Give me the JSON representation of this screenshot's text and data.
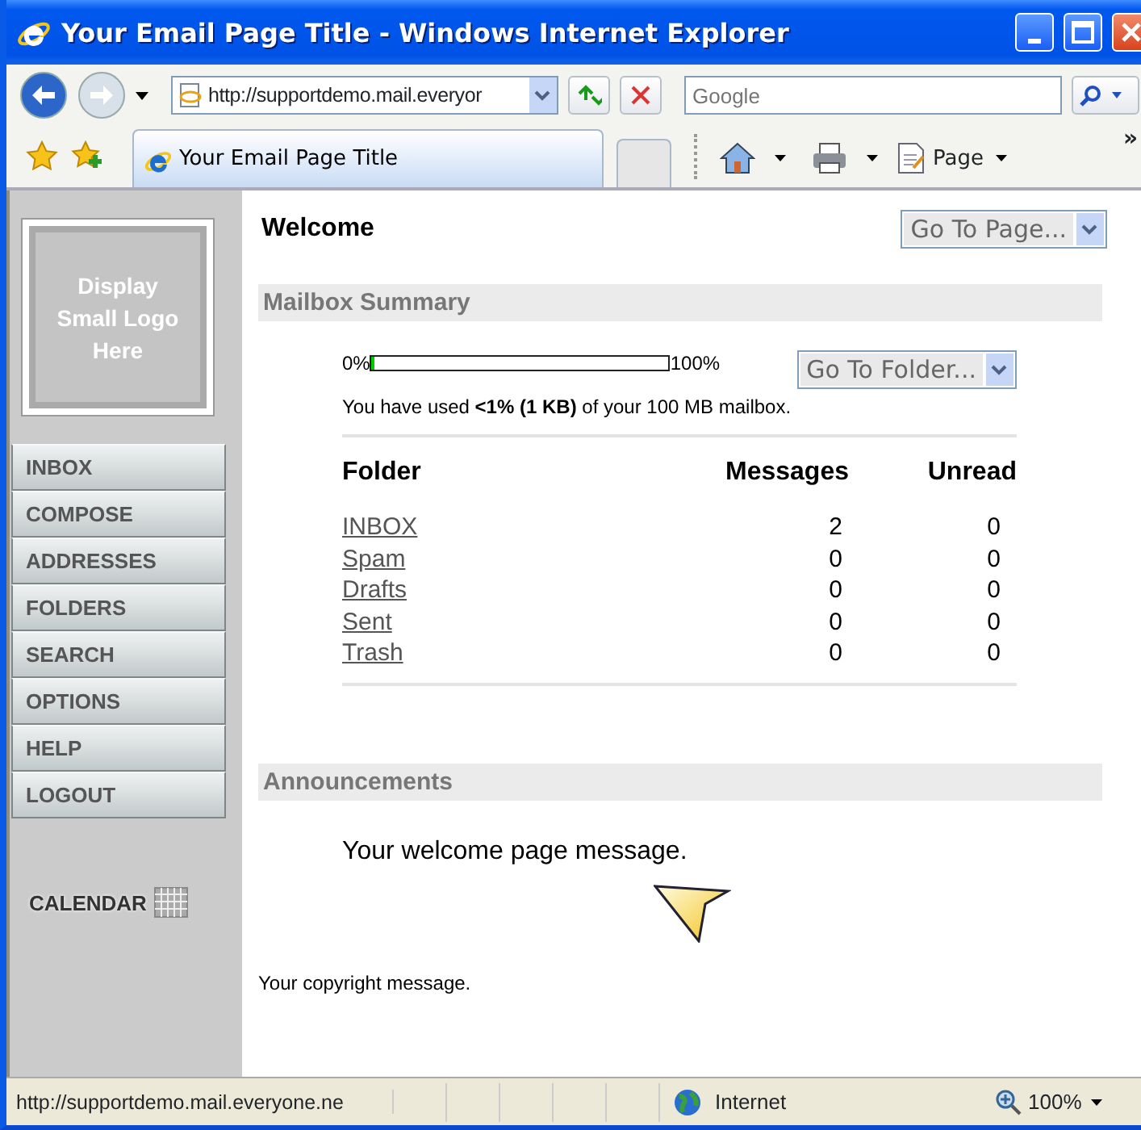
{
  "window": {
    "title": "Your Email Page Title - Windows Internet Explorer"
  },
  "address_bar": {
    "url": "http://supportdemo.mail.everyor"
  },
  "search": {
    "placeholder": "Google"
  },
  "tabs": [
    {
      "label": "Your Email Page Title",
      "selected": true
    }
  ],
  "command_bar": {
    "page_menu": "Page",
    "more": "»"
  },
  "sidebar": {
    "logo_text": "Display Small Logo Here",
    "items": [
      {
        "label": "INBOX"
      },
      {
        "label": "COMPOSE"
      },
      {
        "label": "ADDRESSES"
      },
      {
        "label": "FOLDERS"
      },
      {
        "label": "SEARCH"
      },
      {
        "label": "OPTIONS"
      },
      {
        "label": "HELP"
      },
      {
        "label": "LOGOUT"
      }
    ],
    "calendar": "CALENDAR"
  },
  "welcome": {
    "heading": "Welcome",
    "go_to_page": "Go To Page..."
  },
  "mailbox_summary": {
    "title": "Mailbox Summary",
    "usage": {
      "min_label": "0%",
      "level": 0.01,
      "max_label": "100%",
      "text": "You have used **<1% (1 KB)** of your 100 MB mailbox."
    },
    "go_to_folder": "Go To Folder...",
    "table": {
      "columns": [
        "Folder",
        "Messages",
        "Unread"
      ],
      "rows": [
        {
          "folder": "INBOX",
          "messages": "2",
          "unread": "0"
        },
        {
          "folder": "Spam",
          "messages": "0",
          "unread": "0"
        },
        {
          "folder": "Drafts",
          "messages": "0",
          "unread": "0"
        },
        {
          "folder": "Sent",
          "messages": "0",
          "unread": "0"
        },
        {
          "folder": "Trash",
          "messages": "0",
          "unread": "0"
        }
      ]
    }
  },
  "announcements": {
    "title": "Announcements",
    "message": "Your welcome page message."
  },
  "footer": {
    "copyright": "Your copyright message."
  },
  "status_bar": {
    "url": "http://supportdemo.mail.everyone.ne",
    "zone": "Internet",
    "zoom": "100%"
  }
}
